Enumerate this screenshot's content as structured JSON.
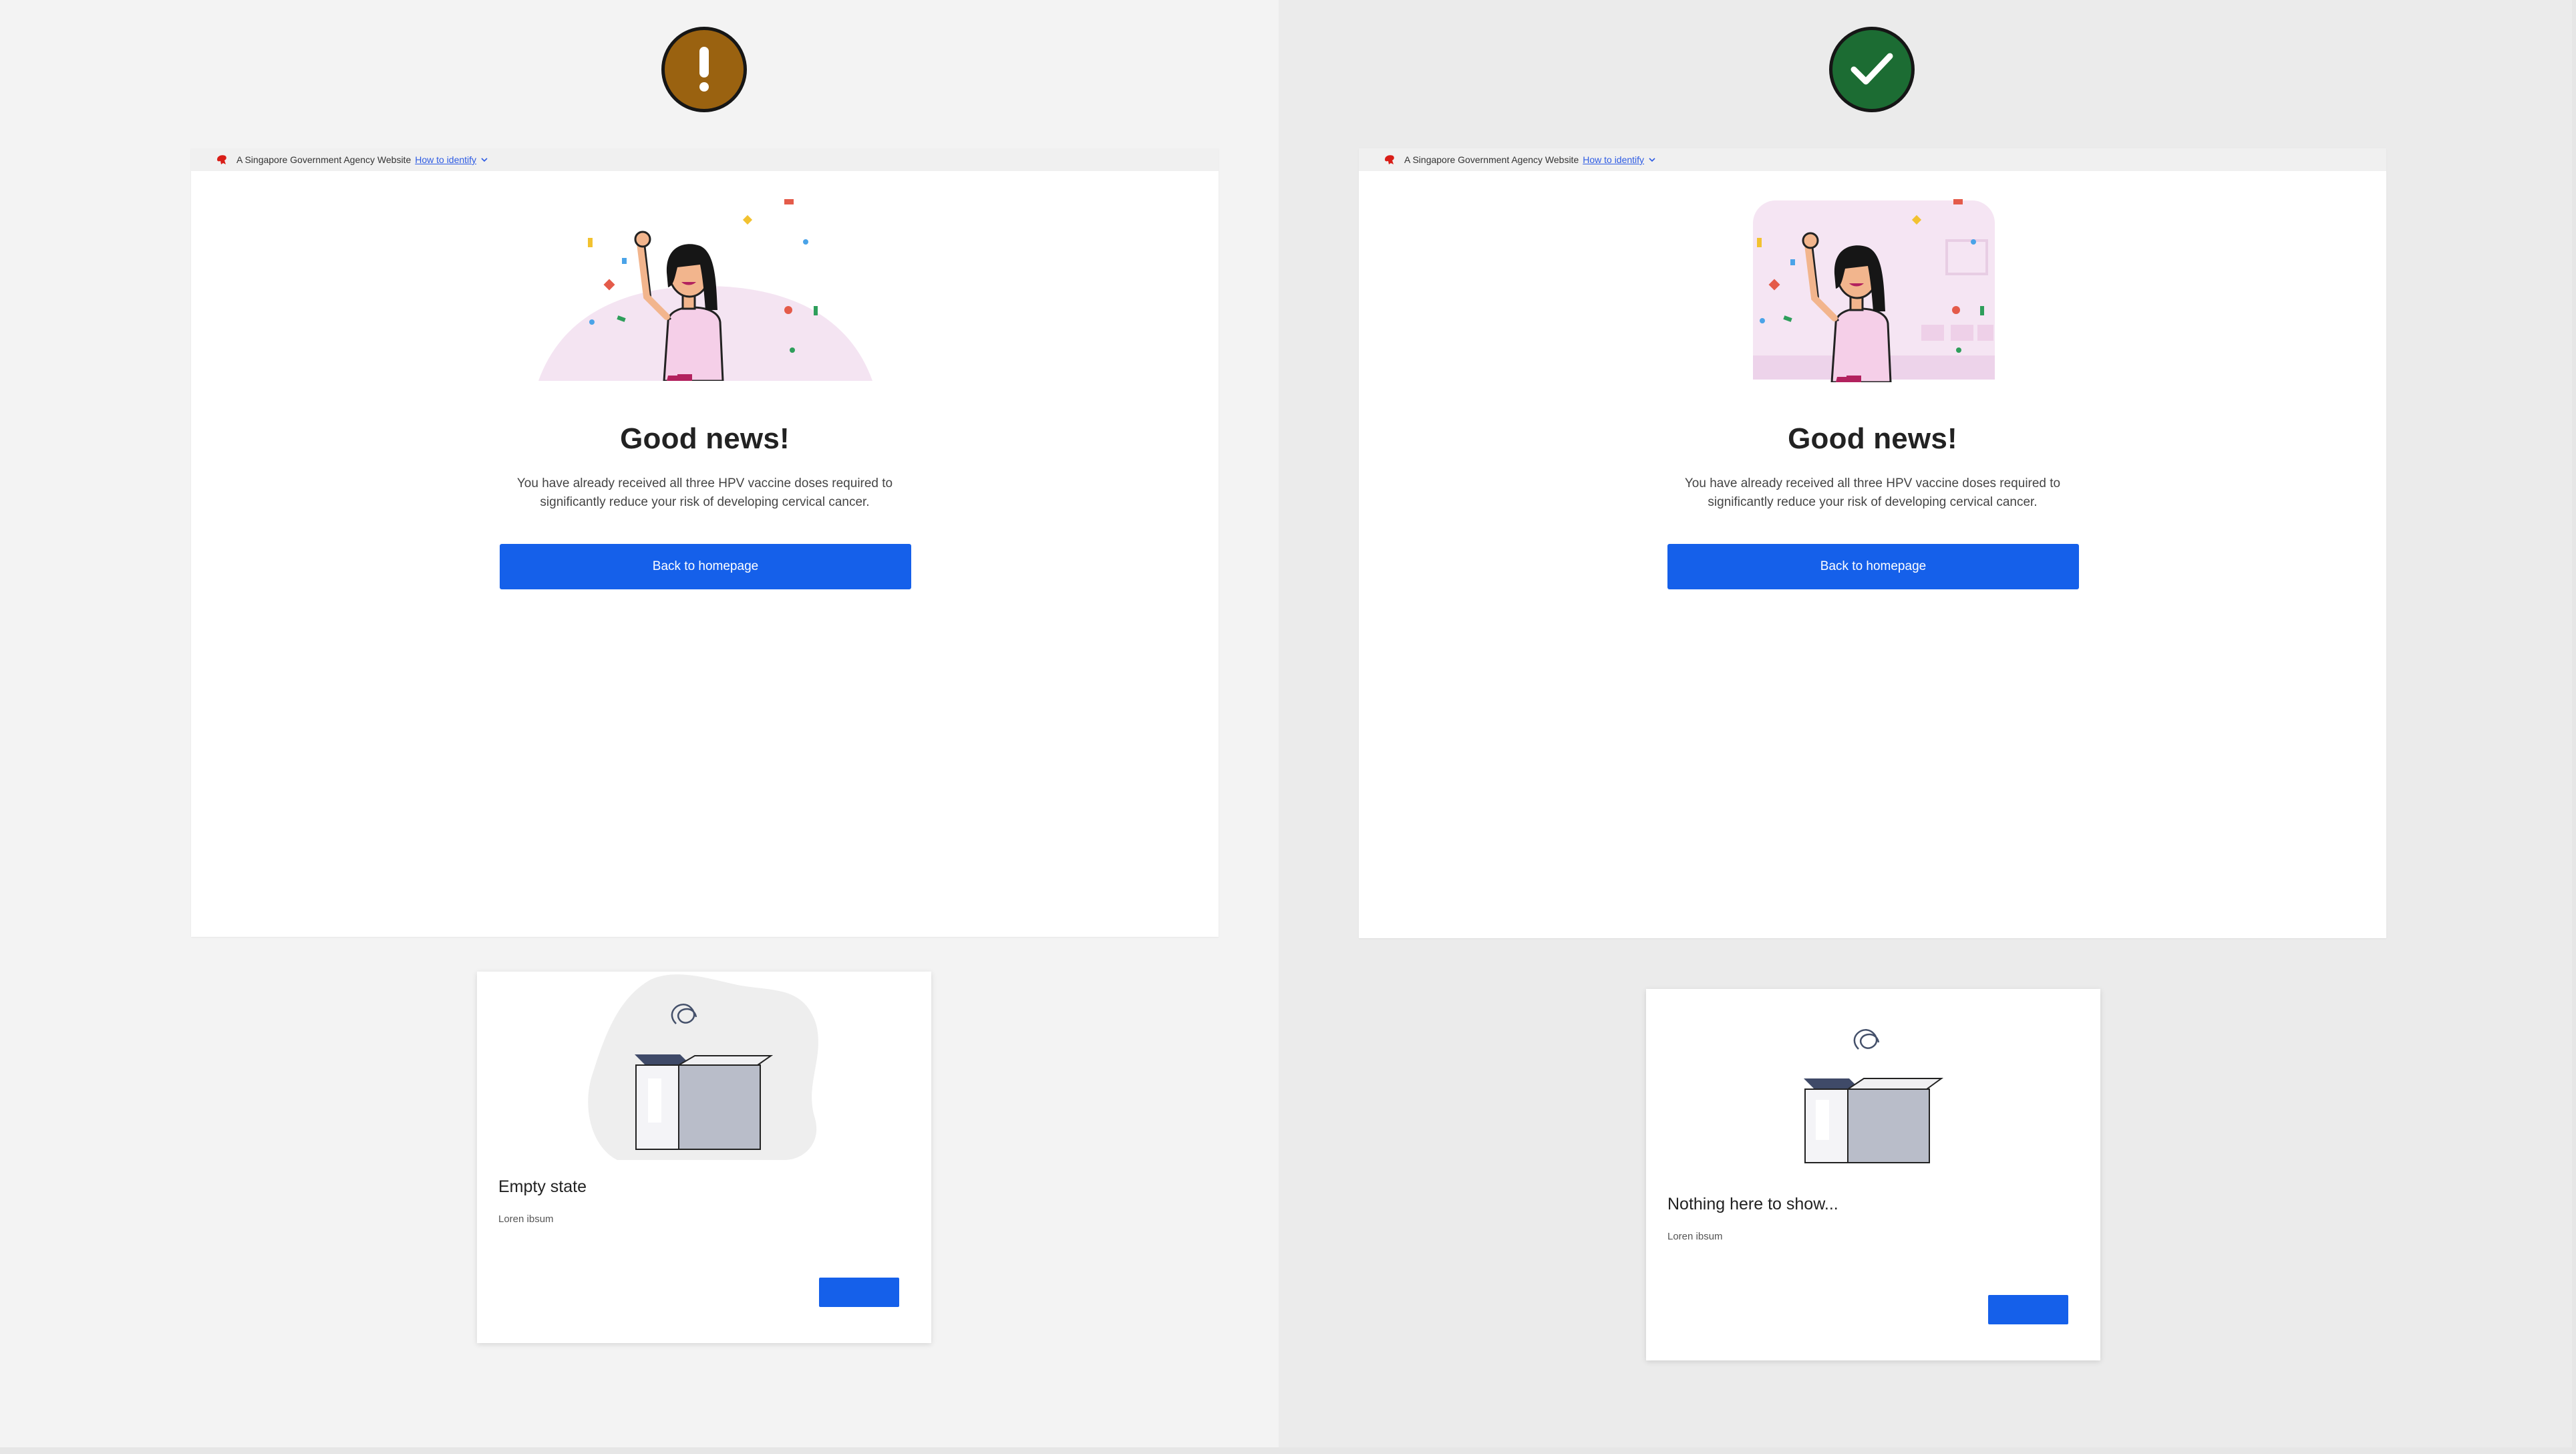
{
  "comparison": {
    "bad": {
      "badge_icon": "exclamation-icon",
      "badge_color": "#9a6210",
      "masthead": {
        "agency_text": "A Singapore Government Agency Website",
        "link_text": "How to identify"
      },
      "page": {
        "headline": "Good news!",
        "body": "You have already received all three HPV vaccine doses required to significantly reduce your risk of developing cervical cancer.",
        "button_label": "Back to homepage"
      },
      "card": {
        "title": "Empty state",
        "body": "Loren ibsum"
      }
    },
    "good": {
      "badge_icon": "checkmark-icon",
      "badge_color": "#1c6c33",
      "masthead": {
        "agency_text": "A Singapore Government Agency Website",
        "link_text": "How to identify"
      },
      "page": {
        "headline": "Good news!",
        "body": "You have already received all three HPV vaccine doses required to significantly reduce your risk of developing cervical cancer.",
        "button_label": "Back to homepage"
      },
      "card": {
        "title": "Nothing here to show...",
        "body": "Loren ibsum"
      }
    }
  },
  "colors": {
    "primary_button": "#1560ea",
    "link": "#2d5be3",
    "illustration_pink": "#f3e3f1"
  }
}
